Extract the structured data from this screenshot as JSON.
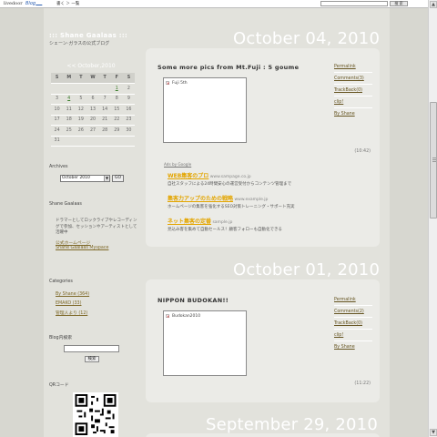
{
  "topbar": {
    "logo": "livedoor",
    "blog": "Blog",
    "nav": "書く ＞ 一覧",
    "search_button": "検 索"
  },
  "blog": {
    "title": "::: Shane Gaalaas :::",
    "subtitle": "シェーン·ガラスの公式ブログ"
  },
  "calendar": {
    "title": "<<   October,2010",
    "weekdays": [
      "S",
      "M",
      "T",
      "W",
      "T",
      "F",
      "S"
    ],
    "weeks": [
      [
        "",
        "",
        "",
        "",
        "",
        "1",
        "2"
      ],
      [
        "3",
        "4",
        "5",
        "6",
        "7",
        "8",
        "9"
      ],
      [
        "10",
        "11",
        "12",
        "13",
        "14",
        "15",
        "16"
      ],
      [
        "17",
        "18",
        "19",
        "20",
        "21",
        "22",
        "23"
      ],
      [
        "24",
        "25",
        "26",
        "27",
        "28",
        "29",
        "30"
      ],
      [
        "31",
        "",
        "",
        "",
        "",
        "",
        ""
      ]
    ],
    "linked_days": [
      "1",
      "4"
    ]
  },
  "sidebar": {
    "archives_label": "Archives",
    "archive_selected": "October 2010",
    "archive_go": "GO",
    "profile_label": "Shane Gaalaas",
    "profile_text": "ドラマーとしてロックライブやレコーディングで参加、セッションやアーティストとして活躍中",
    "profile_links": [
      "公式ホームページ",
      "Shane Gaalaas Myspace"
    ],
    "categories_label": "Categories",
    "categories": [
      "By Shane (364)",
      "EMAKO (33)",
      "管理人より (12)"
    ],
    "blogsearch_label": "Blog内検索",
    "blogsearch_button": "検索",
    "qr_label": "QRコード"
  },
  "posts": [
    {
      "date": "October 04, 2010",
      "title": "Some more pics from Mt.Fuji : 5 goume",
      "image_alt": "Fuji 5th",
      "time": "(10:42)",
      "links": [
        "Permalink",
        "Comments(3)",
        "TrackBack(0)",
        "clip!",
        "By Shane"
      ]
    },
    {
      "date": "October 01, 2010",
      "title": "NIPPON BUDOKAN!!",
      "image_alt": "Budokan2010",
      "time": "(11:22)",
      "links": [
        "Permalink",
        "Comments(2)",
        "TrackBack(0)",
        "clip!",
        "By Shane"
      ]
    },
    {
      "date": "September 29, 2010"
    }
  ],
  "ads": {
    "label": "Ads by Google",
    "items": [
      {
        "head": "WEB集客のプロ",
        "url": "www.sampage.co.jp",
        "desc": "自社スタッフによる24時間安心の運営受付からコンテンツ管理まで"
      },
      {
        "head": "集客力アップのための戦略",
        "url": "www.example.jp",
        "desc": "ホームページの集客を強化するSEO対策トレーニング・サポート充実"
      },
      {
        "head": "ネット集客の定番",
        "url": "sample.jp",
        "desc": "見込み客を集めて自動セールス！顧客フォローも自動化できる"
      }
    ]
  }
}
